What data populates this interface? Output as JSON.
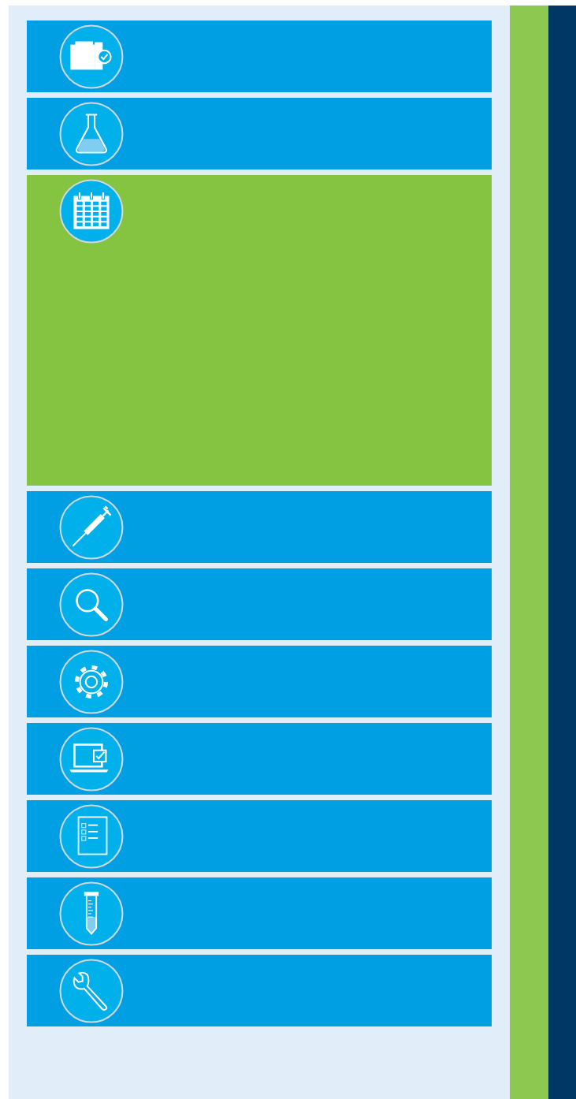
{
  "menu": {
    "items": [
      {
        "kind": "folders",
        "selected": false
      },
      {
        "kind": "flask",
        "selected": false
      },
      {
        "kind": "calendar",
        "selected": true
      },
      {
        "kind": "pipette",
        "selected": false
      },
      {
        "kind": "search",
        "selected": false
      },
      {
        "kind": "gear",
        "selected": false
      },
      {
        "kind": "laptop",
        "selected": false
      },
      {
        "kind": "checklist",
        "selected": false
      },
      {
        "kind": "tube",
        "selected": false
      },
      {
        "kind": "wrench",
        "selected": false
      }
    ]
  }
}
